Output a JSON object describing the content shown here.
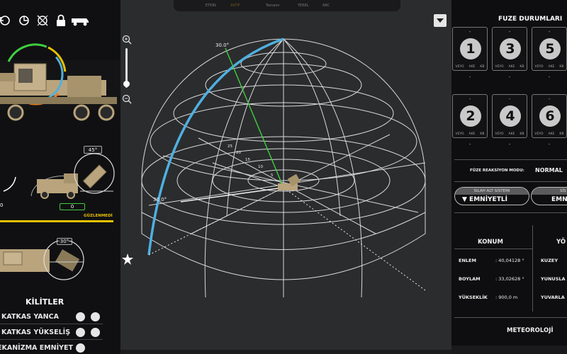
{
  "toolbar": {
    "icons": [
      "rotate-ccw-icon",
      "rotate-cw-icon",
      "no-signal-icon",
      "lock-icon",
      "truck-icon"
    ]
  },
  "left": {
    "elevation_badge": "45°",
    "counter_value": "0",
    "counter_left_value": "0",
    "status_text": "GÜZLENMEDİ",
    "traverse_badge": "30°",
    "locks_title": "KİLİTLER",
    "locks": [
      {
        "label": "KATKAS YANCA"
      },
      {
        "label": "KATKAS YÜKSELİŞ"
      },
      {
        "label": "EKANİZMA EMNİYET"
      }
    ]
  },
  "topbar": {
    "items": [
      "ETKİN",
      "AKTİF",
      "Tamamı",
      "YEREL",
      "ARC"
    ]
  },
  "view": {
    "zoom_in": "+",
    "zoom_out": "−",
    "elev_label": "30.0°",
    "az_label": "30.0°",
    "ranges": [
      "25",
      "20",
      "15",
      "10",
      "5"
    ],
    "collapse": "▼"
  },
  "right": {
    "title": "FUZE DURUMLARI",
    "missiles": [
      {
        "num": "1",
        "top": "-",
        "bottom": "-",
        "tags": [
          "VEYO",
          "AKE",
          "KB"
        ]
      },
      {
        "num": "3",
        "top": "-",
        "bottom": "-",
        "tags": [
          "VEYO",
          "AKE",
          "KB"
        ]
      },
      {
        "num": "5",
        "top": "-",
        "bottom": "-",
        "tags": [
          "VEYO",
          "AKE",
          "KB"
        ]
      },
      {
        "num": "2",
        "top": "-",
        "bottom": "-",
        "tags": [
          "VEYO",
          "AKE",
          "KB"
        ]
      },
      {
        "num": "4",
        "top": "-",
        "bottom": "-",
        "tags": [
          "VEYO",
          "AKE",
          "KB"
        ]
      },
      {
        "num": "6",
        "top": "-",
        "bottom": "-",
        "tags": [
          "VEYO",
          "AKE",
          "KB"
        ]
      }
    ],
    "reaction_label": "FÜZE REAKSİYON MODU:",
    "reaction_value": "NORMAL",
    "subsystem": {
      "top": "SILAH ALT SISTEMI",
      "value": "▼ EMNİYETLİ"
    },
    "subsystem2": {
      "top": "SİS",
      "value": "EMN"
    },
    "position_title": "KONUM",
    "position_title2": "YÖ",
    "position": [
      {
        "label": "ENLEM",
        "value": ": 40,04128 °"
      },
      {
        "label": "BOYLAM",
        "value": ": 33,02628 °"
      },
      {
        "label": "YÜKSEKLİK",
        "value": ": 900,0 m"
      }
    ],
    "orient": [
      "KUZEY",
      "YUNUSLA",
      "YUVARLA"
    ],
    "meteo_title": "METEOROLOJİ"
  },
  "colors": {
    "accent_blue": "#4fb0e0",
    "accent_green": "#3fcf3f",
    "accent_yellow": "#e8c200",
    "tan": "#b9a47d"
  }
}
